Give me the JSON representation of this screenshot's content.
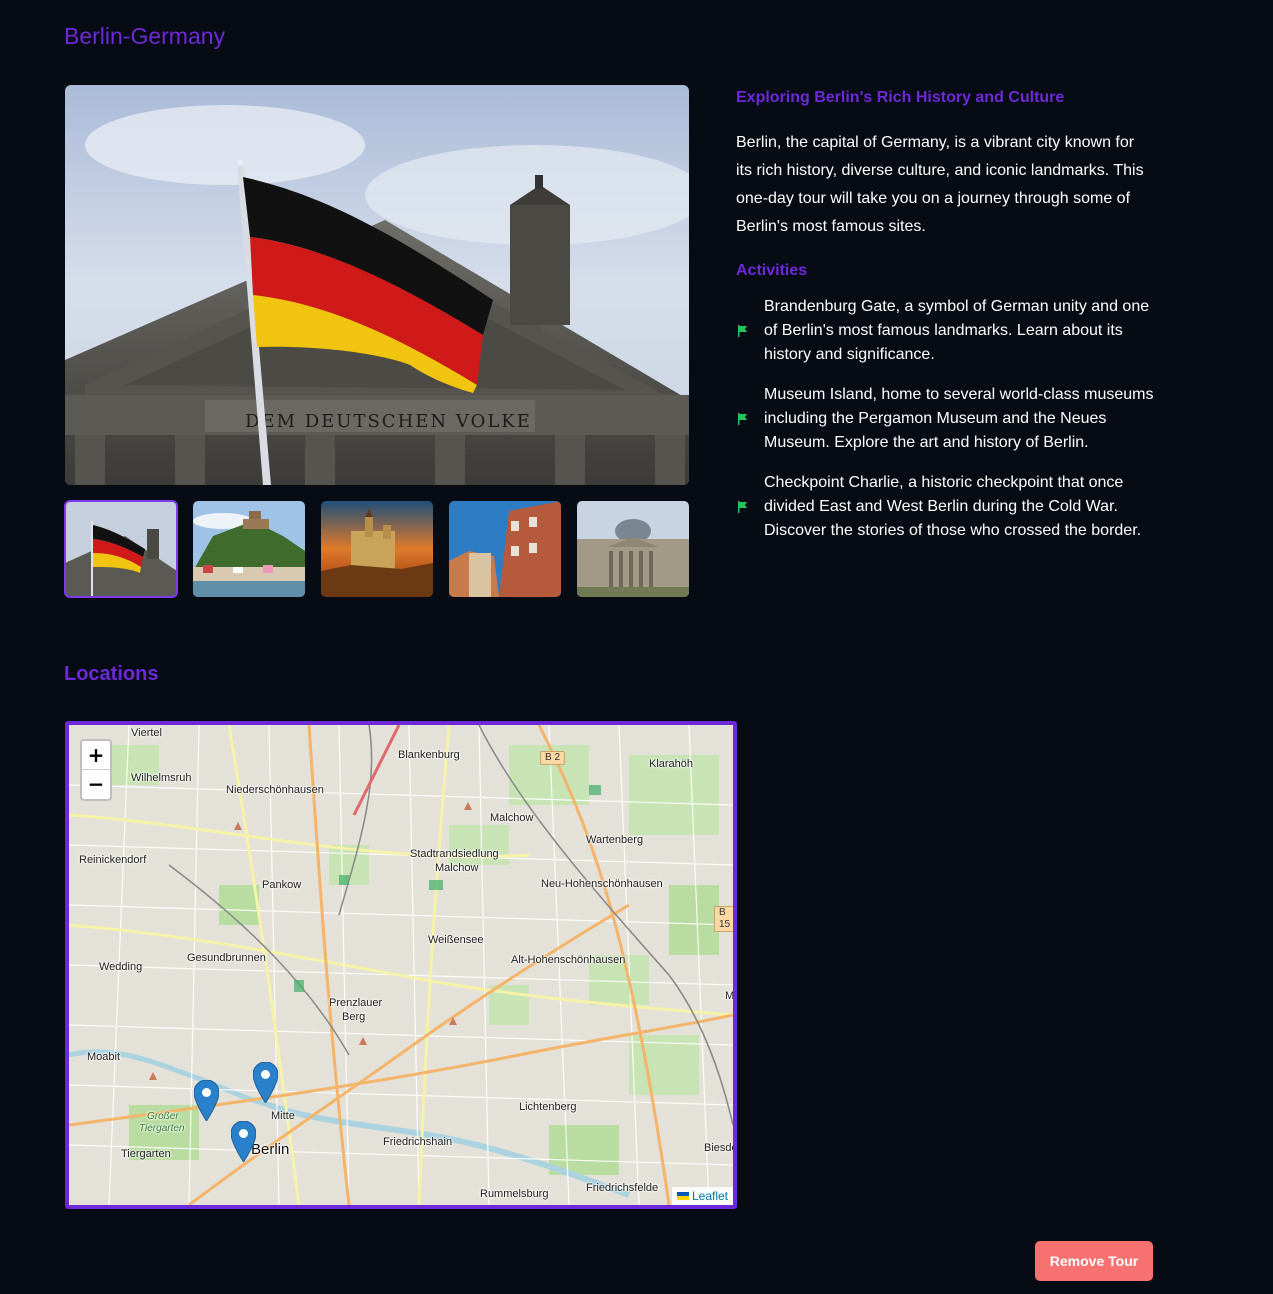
{
  "page": {
    "title": "Berlin-Germany"
  },
  "gallery": {
    "main_image": "reichstag-german-flag",
    "main_inscription": "DEM DEUTSCHEN VOLKE",
    "thumbnails": [
      {
        "name": "reichstag-flag",
        "active": true
      },
      {
        "name": "castle-on-hill-village",
        "active": false
      },
      {
        "name": "castle-sunset",
        "active": false
      },
      {
        "name": "half-timbered-houses",
        "active": false
      },
      {
        "name": "reichstag-building",
        "active": false
      }
    ]
  },
  "info": {
    "heading": "Exploring Berlin's Rich History and Culture",
    "description": "Berlin, the capital of Germany, is a vibrant city known for its rich history, diverse culture, and iconic landmarks. This one-day tour will take you on a journey through some of Berlin's most famous sites.",
    "activities_heading": "Activities",
    "activities": [
      {
        "icon": "flag-icon",
        "text": "Brandenburg Gate, a symbol of German unity and one of Berlin's most famous landmarks. Learn about its history and significance."
      },
      {
        "icon": "flag-icon",
        "text": "Museum Island, home to several world-class museums including the Pergamon Museum and the Neues Museum. Explore the art and history of Berlin."
      },
      {
        "icon": "flag-icon",
        "text": "Checkpoint Charlie, a historic checkpoint that once divided East and West Berlin during the Cold War. Discover the stories of those who crossed the border."
      }
    ]
  },
  "locations": {
    "heading": "Locations",
    "zoom_in": "+",
    "zoom_out": "−",
    "attribution": "Leaflet",
    "labels": {
      "viertel": "Viertel",
      "wilhelmsruh": "Wilhelmsruh",
      "niederschoenhausen": "Niederschönhausen",
      "blankenburg": "Blankenburg",
      "klarahoeh": "Klarahöh",
      "malchow": "Malchow",
      "wartenberg": "Wartenberg",
      "reinickendorf": "Reinickendorf",
      "stadtrandsiedlung": "Stadtrandsiedlung",
      "malchow2": "Malchow",
      "pankow": "Pankow",
      "neu_hohenschoenhausen": "Neu-Hohenschönhausen",
      "weissensee": "Weißensee",
      "wedding": "Wedding",
      "gesundbrunnen": "Gesundbrunnen",
      "alt_hohenschoenhausen": "Alt-Hohenschönhausen",
      "prenzlauer": "Prenzlauer",
      "berg": "Berg",
      "moabit": "Moabit",
      "mitte": "Mitte",
      "grosser": "Großer",
      "tiergarten_park": "Tiergarten",
      "lichtenberg": "Lichtenberg",
      "tiergarten": "Tiergarten",
      "berlin": "Berlin",
      "friedrichshain": "Friedrichshain",
      "biesdorf": "Biesdo",
      "rummelsburg": "Rummelsburg",
      "friedrichsfelde": "Friedrichsfelde",
      "b2": "B 2",
      "b15": "B 15",
      "m": "M"
    }
  },
  "actions": {
    "remove_label": "Remove Tour",
    "remove_color": "#f87171"
  },
  "colors": {
    "accent": "#6d28d9",
    "background": "#070b13",
    "activity_flag": "#22c55e"
  }
}
